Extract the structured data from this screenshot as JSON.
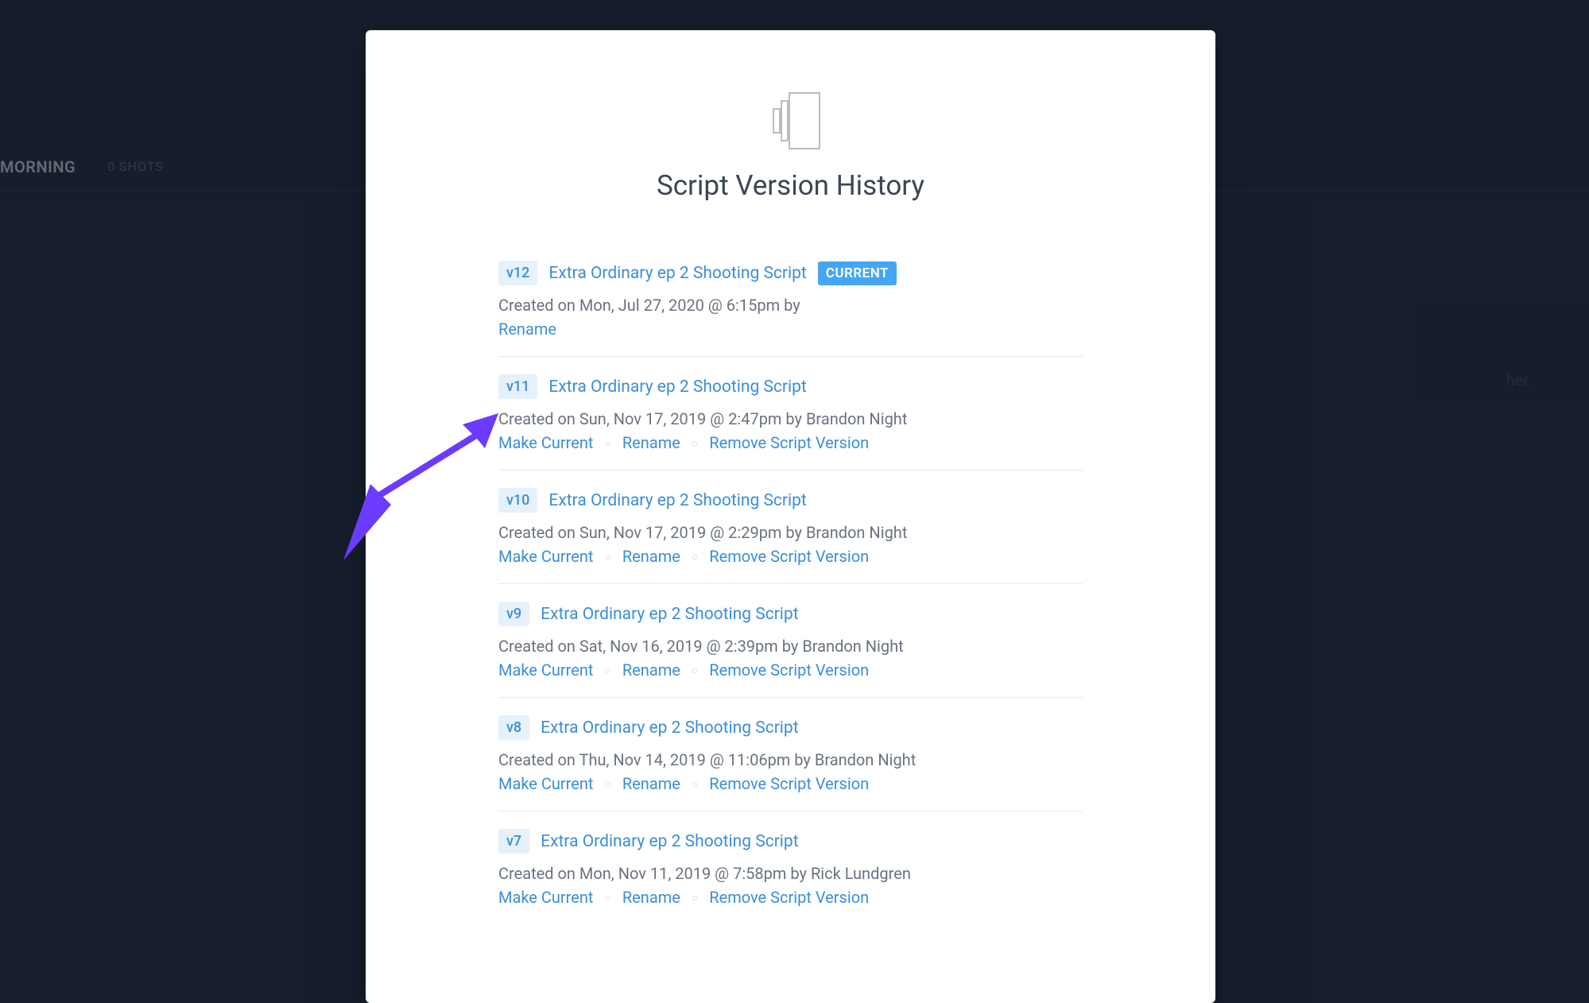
{
  "background": {
    "scene_label": "MORNING",
    "shots_label": "0 SHOTS",
    "right_text": "her."
  },
  "modal": {
    "title": "Script Version History",
    "current_badge": "CURRENT",
    "action_labels": {
      "rename": "Rename",
      "make_current": "Make Current",
      "remove": "Remove Script Version"
    },
    "versions": [
      {
        "tag": "v12",
        "title": "Extra Ordinary ep 2 Shooting Script",
        "meta": "Created on Mon, Jul 27, 2020 @ 6:15pm by",
        "current": true
      },
      {
        "tag": "v11",
        "title": "Extra Ordinary ep 2 Shooting Script",
        "meta": "Created on Sun, Nov 17, 2019 @ 2:47pm by Brandon Night",
        "current": false
      },
      {
        "tag": "v10",
        "title": "Extra Ordinary ep 2 Shooting Script",
        "meta": "Created on Sun, Nov 17, 2019 @ 2:29pm by Brandon Night",
        "current": false
      },
      {
        "tag": "v9",
        "title": "Extra Ordinary ep 2 Shooting Script",
        "meta": "Created on Sat, Nov 16, 2019 @ 2:39pm by Brandon Night",
        "current": false
      },
      {
        "tag": "v8",
        "title": "Extra Ordinary ep 2 Shooting Script",
        "meta": "Created on Thu, Nov 14, 2019 @ 11:06pm by Brandon Night",
        "current": false
      },
      {
        "tag": "v7",
        "title": "Extra Ordinary ep 2 Shooting Script",
        "meta": "Created on Mon, Nov 11, 2019 @ 7:58pm by Rick Lundgren",
        "current": false
      }
    ]
  }
}
